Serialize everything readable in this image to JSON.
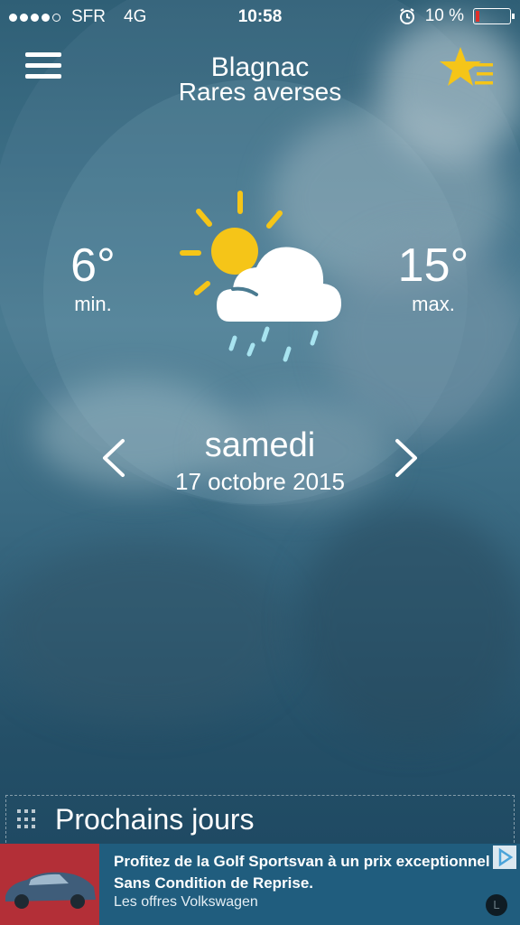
{
  "status_bar": {
    "carrier": "SFR",
    "network": "4G",
    "time": "10:58",
    "battery_percent": "10 %",
    "battery_level": 0.1,
    "signal_bars": 4,
    "icons": [
      "alarm-icon",
      "battery-icon"
    ]
  },
  "header": {
    "city": "Blagnac",
    "condition": "Rares averses"
  },
  "weather": {
    "min_temp": "6°",
    "min_label": "min.",
    "max_temp": "15°",
    "max_label": "max.",
    "icon": "sun-cloud-rain-icon",
    "day": "samedi",
    "date": "17 octobre 2015"
  },
  "next_days": {
    "label": "Prochains jours"
  },
  "ad": {
    "headline": "Profitez de la Golf Sportsvan à un prix exceptionnel Sans Condition de Reprise.",
    "sub": "Les offres Volkswagen",
    "badge": "L"
  },
  "colors": {
    "accent_yellow": "#f5c518",
    "rain_drop": "#a8e4f0",
    "ad_background": "#205d7e"
  }
}
